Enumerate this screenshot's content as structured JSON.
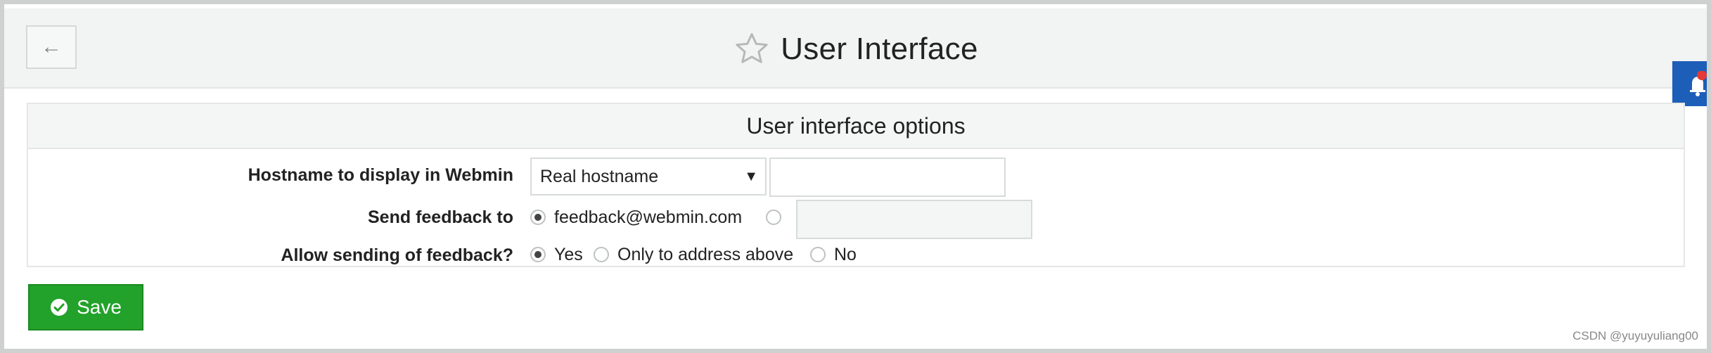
{
  "header": {
    "title": "User Interface",
    "back_symbol": "←"
  },
  "section": {
    "title": "User interface options"
  },
  "fields": {
    "hostname": {
      "label": "Hostname to display in Webmin",
      "selected": "Real hostname",
      "options": [
        "Real hostname"
      ],
      "text_value": ""
    },
    "feedback_to": {
      "label": "Send feedback to",
      "options": [
        "feedback@webmin.com",
        ""
      ],
      "selected_index": 0,
      "custom_value": ""
    },
    "allow_feedback": {
      "label": "Allow sending of feedback?",
      "options": [
        "Yes",
        "Only to address above",
        "No"
      ],
      "selected_index": 0
    }
  },
  "actions": {
    "save_label": "Save"
  },
  "watermark": "CSDN @yuyuyuliang00",
  "colors": {
    "save": "#22a22a",
    "notification": "#1d5eb8",
    "badge": "#e53935"
  }
}
